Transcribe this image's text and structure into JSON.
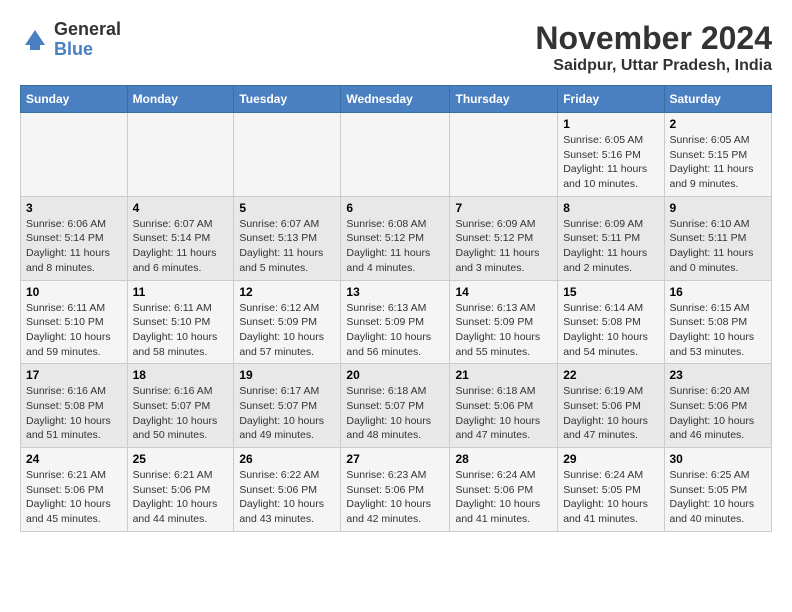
{
  "header": {
    "logo_general": "General",
    "logo_blue": "Blue",
    "month_title": "November 2024",
    "location": "Saidpur, Uttar Pradesh, India"
  },
  "calendar": {
    "days_of_week": [
      "Sunday",
      "Monday",
      "Tuesday",
      "Wednesday",
      "Thursday",
      "Friday",
      "Saturday"
    ],
    "weeks": [
      [
        {
          "day": "",
          "info": ""
        },
        {
          "day": "",
          "info": ""
        },
        {
          "day": "",
          "info": ""
        },
        {
          "day": "",
          "info": ""
        },
        {
          "day": "",
          "info": ""
        },
        {
          "day": "1",
          "info": "Sunrise: 6:05 AM\nSunset: 5:16 PM\nDaylight: 11 hours and 10 minutes."
        },
        {
          "day": "2",
          "info": "Sunrise: 6:05 AM\nSunset: 5:15 PM\nDaylight: 11 hours and 9 minutes."
        }
      ],
      [
        {
          "day": "3",
          "info": "Sunrise: 6:06 AM\nSunset: 5:14 PM\nDaylight: 11 hours and 8 minutes."
        },
        {
          "day": "4",
          "info": "Sunrise: 6:07 AM\nSunset: 5:14 PM\nDaylight: 11 hours and 6 minutes."
        },
        {
          "day": "5",
          "info": "Sunrise: 6:07 AM\nSunset: 5:13 PM\nDaylight: 11 hours and 5 minutes."
        },
        {
          "day": "6",
          "info": "Sunrise: 6:08 AM\nSunset: 5:12 PM\nDaylight: 11 hours and 4 minutes."
        },
        {
          "day": "7",
          "info": "Sunrise: 6:09 AM\nSunset: 5:12 PM\nDaylight: 11 hours and 3 minutes."
        },
        {
          "day": "8",
          "info": "Sunrise: 6:09 AM\nSunset: 5:11 PM\nDaylight: 11 hours and 2 minutes."
        },
        {
          "day": "9",
          "info": "Sunrise: 6:10 AM\nSunset: 5:11 PM\nDaylight: 11 hours and 0 minutes."
        }
      ],
      [
        {
          "day": "10",
          "info": "Sunrise: 6:11 AM\nSunset: 5:10 PM\nDaylight: 10 hours and 59 minutes."
        },
        {
          "day": "11",
          "info": "Sunrise: 6:11 AM\nSunset: 5:10 PM\nDaylight: 10 hours and 58 minutes."
        },
        {
          "day": "12",
          "info": "Sunrise: 6:12 AM\nSunset: 5:09 PM\nDaylight: 10 hours and 57 minutes."
        },
        {
          "day": "13",
          "info": "Sunrise: 6:13 AM\nSunset: 5:09 PM\nDaylight: 10 hours and 56 minutes."
        },
        {
          "day": "14",
          "info": "Sunrise: 6:13 AM\nSunset: 5:09 PM\nDaylight: 10 hours and 55 minutes."
        },
        {
          "day": "15",
          "info": "Sunrise: 6:14 AM\nSunset: 5:08 PM\nDaylight: 10 hours and 54 minutes."
        },
        {
          "day": "16",
          "info": "Sunrise: 6:15 AM\nSunset: 5:08 PM\nDaylight: 10 hours and 53 minutes."
        }
      ],
      [
        {
          "day": "17",
          "info": "Sunrise: 6:16 AM\nSunset: 5:08 PM\nDaylight: 10 hours and 51 minutes."
        },
        {
          "day": "18",
          "info": "Sunrise: 6:16 AM\nSunset: 5:07 PM\nDaylight: 10 hours and 50 minutes."
        },
        {
          "day": "19",
          "info": "Sunrise: 6:17 AM\nSunset: 5:07 PM\nDaylight: 10 hours and 49 minutes."
        },
        {
          "day": "20",
          "info": "Sunrise: 6:18 AM\nSunset: 5:07 PM\nDaylight: 10 hours and 48 minutes."
        },
        {
          "day": "21",
          "info": "Sunrise: 6:18 AM\nSunset: 5:06 PM\nDaylight: 10 hours and 47 minutes."
        },
        {
          "day": "22",
          "info": "Sunrise: 6:19 AM\nSunset: 5:06 PM\nDaylight: 10 hours and 47 minutes."
        },
        {
          "day": "23",
          "info": "Sunrise: 6:20 AM\nSunset: 5:06 PM\nDaylight: 10 hours and 46 minutes."
        }
      ],
      [
        {
          "day": "24",
          "info": "Sunrise: 6:21 AM\nSunset: 5:06 PM\nDaylight: 10 hours and 45 minutes."
        },
        {
          "day": "25",
          "info": "Sunrise: 6:21 AM\nSunset: 5:06 PM\nDaylight: 10 hours and 44 minutes."
        },
        {
          "day": "26",
          "info": "Sunrise: 6:22 AM\nSunset: 5:06 PM\nDaylight: 10 hours and 43 minutes."
        },
        {
          "day": "27",
          "info": "Sunrise: 6:23 AM\nSunset: 5:06 PM\nDaylight: 10 hours and 42 minutes."
        },
        {
          "day": "28",
          "info": "Sunrise: 6:24 AM\nSunset: 5:06 PM\nDaylight: 10 hours and 41 minutes."
        },
        {
          "day": "29",
          "info": "Sunrise: 6:24 AM\nSunset: 5:05 PM\nDaylight: 10 hours and 41 minutes."
        },
        {
          "day": "30",
          "info": "Sunrise: 6:25 AM\nSunset: 5:05 PM\nDaylight: 10 hours and 40 minutes."
        }
      ]
    ]
  }
}
